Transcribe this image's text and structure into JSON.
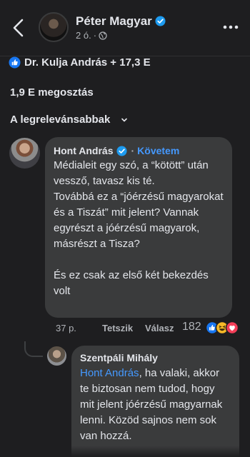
{
  "header": {
    "page_name": "Péter Magyar",
    "post_age": "2 ó.",
    "separator": "·"
  },
  "reactions": {
    "summary": "Dr. Kulja András + 17,3 E"
  },
  "shares": "1,9 E megosztás",
  "sort": {
    "label": "A legrelevánsabbak"
  },
  "comments": [
    {
      "author": "Hont András",
      "follow_label": "Követem",
      "text": "Médialeit egy szó, a “kötött” után vessző, tavasz kis té.\nTovábbá ez a “jóérzésű magyarokat és a Tiszát” mit jelent? Vannak egyrészt a jóérzésű magyarok, másrészt a Tisza?\n\nÉs ez csak az első két bekezdés volt",
      "time": "37 p.",
      "like_label": "Tetszik",
      "reply_label": "Válasz",
      "reaction_count": "182"
    },
    {
      "author": "Szentpáli Mihály",
      "mention": "Hont András",
      "text": ", ha valaki, akkor te biztosan nem tudod, hogy mit jelent jóérzésű magyarnak lenni. Közöd sajnos nem sok van hozzá."
    }
  ],
  "colors": {
    "background": "#1e1e20",
    "bubble": "#3a3b3c",
    "accent": "#4599ff",
    "muted": "#b0b3b8"
  },
  "icons": [
    "back-arrow-icon",
    "verified-badge-icon",
    "globe-icon",
    "more-dots-icon",
    "like-badge-icon",
    "chevron-down-icon",
    "haha-reaction-icon",
    "love-reaction-icon"
  ]
}
